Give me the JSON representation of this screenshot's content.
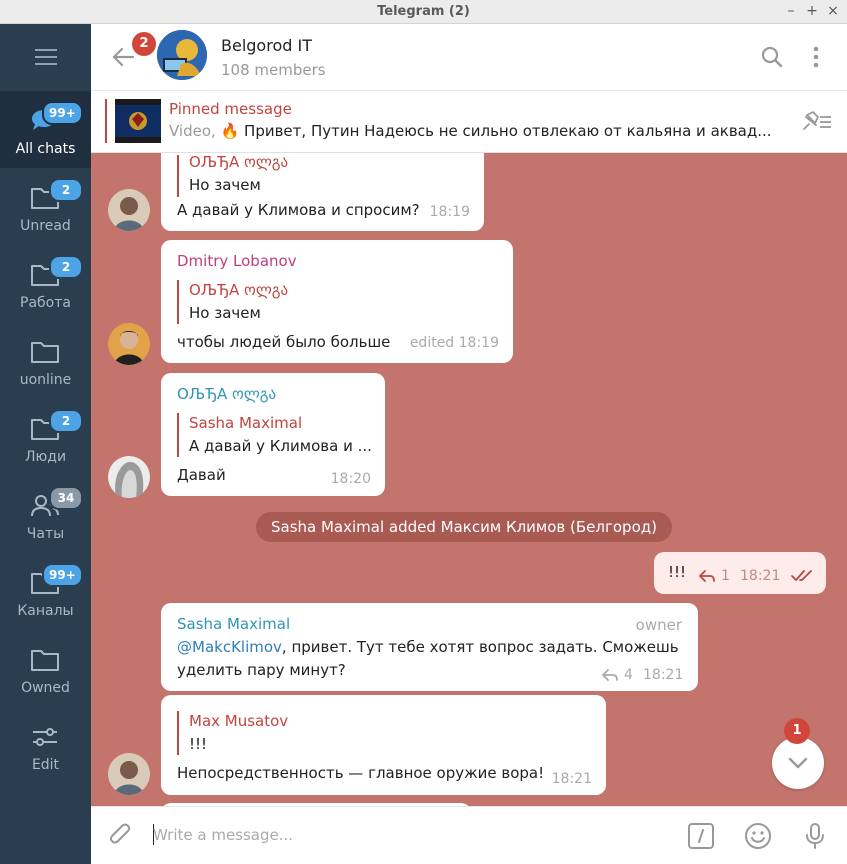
{
  "window": {
    "title": "Telegram (2)",
    "controls": [
      "–",
      "+",
      "×"
    ]
  },
  "sidebar": {
    "folders": [
      {
        "label": "All chats",
        "badge": "99+",
        "active": true
      },
      {
        "label": "Unread",
        "badge": "2"
      },
      {
        "label": "Работа",
        "badge": "2"
      },
      {
        "label": "uonline",
        "badge": ""
      },
      {
        "label": "Люди",
        "badge": "2"
      },
      {
        "label": "Чаты",
        "badge": "34"
      },
      {
        "label": "Каналы",
        "badge": "99+"
      },
      {
        "label": "Owned",
        "badge": ""
      },
      {
        "label": "Edit",
        "badge": ""
      }
    ]
  },
  "header": {
    "back_badge": "2",
    "chat_title": "Belgorod IT",
    "chat_subtitle": "108 members"
  },
  "pinned": {
    "title": "Pinned message",
    "media_label": "Video,",
    "emoji": "🔥",
    "text": "Привет, Путин  Надеюсь не сильно отвлекаю от кальяна и аквад..."
  },
  "messages": {
    "m1": {
      "reply_name": "ОЉЂА ოლგა",
      "reply_text": "Но зачем",
      "text": "А давай у Климова и спросим?",
      "time": "18:19"
    },
    "m2": {
      "sender": "Dmitry Lobanov",
      "reply_name": "ОЉЂА ოლგა",
      "reply_text": "Но зачем",
      "text": "чтобы людей было больше",
      "time": "edited 18:19"
    },
    "m3": {
      "sender": "ОЉЂА ოლგა",
      "reply_name": "Sasha Maximal",
      "reply_text": "А давай у Климова и ...",
      "text": "Давай",
      "time": "18:20"
    },
    "service": "Sasha Maximal added Максим Климов (Белгород)",
    "m4": {
      "text": "!!!",
      "replies": "1",
      "time": "18:21"
    },
    "m5": {
      "sender": "Sasha Maximal",
      "role": "owner",
      "mention": "@MakcKlimov",
      "text_line1": ", привет. Тут тебе хотят вопрос задать. Сможешь",
      "text_line2": "уделить пару минут?",
      "replies": "4",
      "time": "18:21"
    },
    "m6": {
      "reply_name": "Max Musatov",
      "reply_text": "!!!",
      "text": "Непосредственность — главное оружие вора!",
      "time": "18:21"
    }
  },
  "scroll_badge": "1",
  "composer": {
    "placeholder": "Write a message..."
  },
  "colors": {
    "sidebar_bg": "#2b3e50",
    "chat_bg": "#c3756d",
    "accent_red": "#c0453e",
    "badge_blue": "#4ca3e6",
    "name_pink": "#c03d7d",
    "name_teal": "#2e96b5"
  }
}
